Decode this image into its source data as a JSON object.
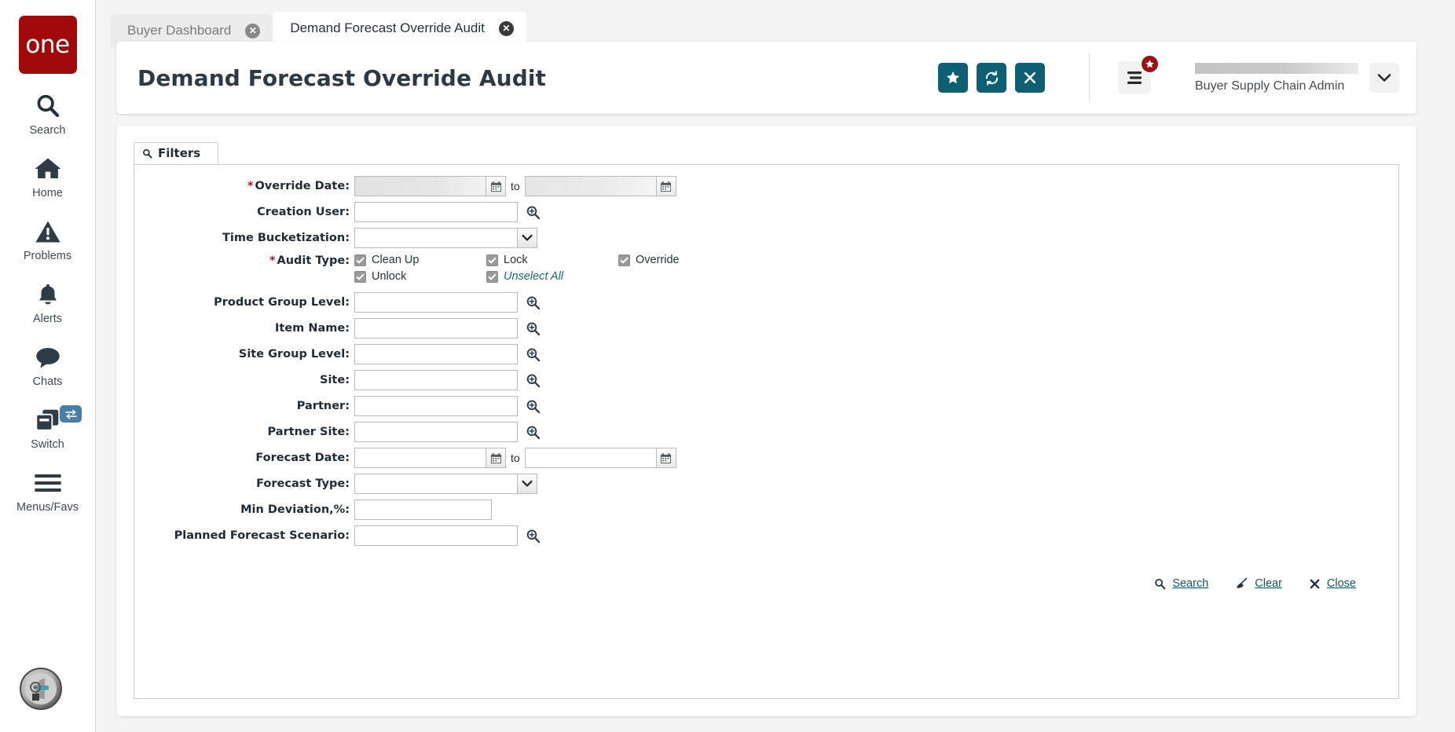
{
  "brand": {
    "logo_text": "one",
    "logo_color": "#a00a0a",
    "accent_color": "#0d5f73"
  },
  "sidebar": {
    "items": [
      {
        "label": "Search",
        "icon": "search-icon"
      },
      {
        "label": "Home",
        "icon": "home-icon"
      },
      {
        "label": "Problems",
        "icon": "warning-triangle-icon"
      },
      {
        "label": "Alerts",
        "icon": "bell-icon"
      },
      {
        "label": "Chats",
        "icon": "chat-bubble-icon"
      },
      {
        "label": "Switch",
        "icon": "windows-stack-icon",
        "badge_icon": "swap-arrows-icon"
      },
      {
        "label": "Menus/Favs",
        "icon": "hamburger-icon"
      }
    ],
    "avatar_icon": "ai-head-avatar-icon"
  },
  "tabs": [
    {
      "label": "Buyer Dashboard",
      "active": false,
      "close_icon": "close-circle-icon"
    },
    {
      "label": "Demand Forecast Override Audit",
      "active": true,
      "close_icon": "close-circle-icon"
    }
  ],
  "header": {
    "title": "Demand Forecast Override Audit",
    "actions": [
      {
        "name": "favorite-button",
        "icon": "star-icon"
      },
      {
        "name": "refresh-button",
        "icon": "refresh-icon"
      },
      {
        "name": "close-button",
        "icon": "x-icon"
      }
    ],
    "menu_button_icon": "menu-lines-icon",
    "menu_badge_icon": "star-icon",
    "user_role": "Buyer Supply Chain Admin",
    "user_caret_icon": "chevron-down-icon"
  },
  "filters": {
    "tab_label": "Filters",
    "tab_icon": "search-icon",
    "fields": [
      {
        "label": "Override Date:",
        "required": true,
        "type": "date-range",
        "value_from": "",
        "value_to": "",
        "redacted": true,
        "to_label": "to",
        "calendar_icon": "calendar-icon"
      },
      {
        "label": "Creation User:",
        "required": false,
        "type": "text-lookup",
        "value": "",
        "lookup_icon": "magnifier-plus-icon"
      },
      {
        "label": "Time Bucketization:",
        "required": false,
        "type": "select",
        "value": "",
        "caret_icon": "chevron-down-icon"
      },
      {
        "label": "Audit Type:",
        "required": true,
        "type": "checkbox-group"
      },
      {
        "label": "Product Group Level:",
        "required": false,
        "type": "text-lookup",
        "value": "",
        "lookup_icon": "magnifier-plus-icon"
      },
      {
        "label": "Item Name:",
        "required": false,
        "type": "text-lookup",
        "value": "",
        "lookup_icon": "magnifier-plus-icon"
      },
      {
        "label": "Site Group Level:",
        "required": false,
        "type": "text-lookup",
        "value": "",
        "lookup_icon": "magnifier-plus-icon"
      },
      {
        "label": "Site:",
        "required": false,
        "type": "text-lookup",
        "value": "",
        "lookup_icon": "magnifier-plus-icon"
      },
      {
        "label": "Partner:",
        "required": false,
        "type": "text-lookup",
        "value": "",
        "lookup_icon": "magnifier-plus-icon"
      },
      {
        "label": "Partner Site:",
        "required": false,
        "type": "text-lookup",
        "value": "",
        "lookup_icon": "magnifier-plus-icon"
      },
      {
        "label": "Forecast Date:",
        "required": false,
        "type": "date-range",
        "value_from": "",
        "value_to": "",
        "redacted": false,
        "to_label": "to",
        "calendar_icon": "calendar-icon"
      },
      {
        "label": "Forecast Type:",
        "required": false,
        "type": "select",
        "value": "",
        "caret_icon": "chevron-down-icon"
      },
      {
        "label": "Min Deviation,%:",
        "required": false,
        "type": "text",
        "value": ""
      },
      {
        "label": "Planned Forecast Scenario:",
        "required": false,
        "type": "text-lookup",
        "value": "",
        "lookup_icon": "magnifier-plus-icon"
      }
    ],
    "audit_type": {
      "label": "Audit Type:",
      "options": [
        {
          "label": "Clean Up",
          "checked": true
        },
        {
          "label": "Lock",
          "checked": true
        },
        {
          "label": "Override",
          "checked": true
        },
        {
          "label": "Unlock",
          "checked": true
        }
      ],
      "unselect_all": {
        "label": "Unselect All",
        "checked": true
      }
    },
    "actions": [
      {
        "label": "Search",
        "icon": "search-icon"
      },
      {
        "label": "Clear",
        "icon": "broom-icon"
      },
      {
        "label": "Close",
        "icon": "x-icon"
      }
    ]
  }
}
